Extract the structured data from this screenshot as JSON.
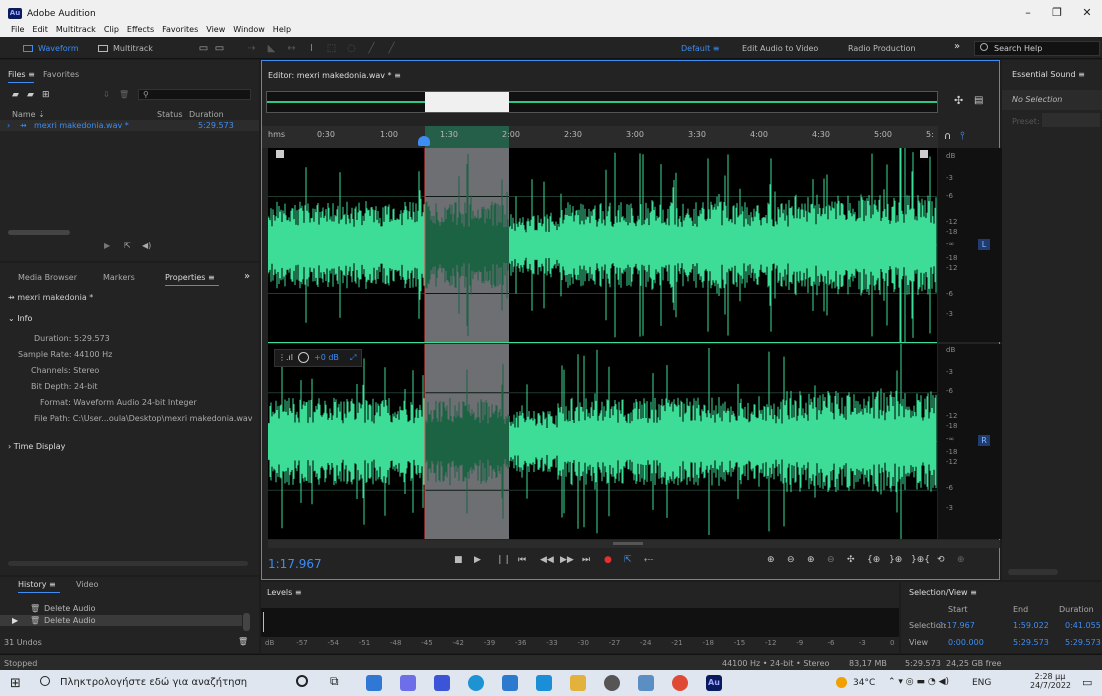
{
  "window": {
    "title": "Adobe Audition",
    "app_badge": "Au"
  },
  "menu": [
    "File",
    "Edit",
    "Multitrack",
    "Clip",
    "Effects",
    "Favorites",
    "View",
    "Window",
    "Help"
  ],
  "toolbar": {
    "waveform_label": "Waveform",
    "multitrack_label": "Multitrack",
    "workspaces": [
      "Default",
      "Edit Audio to Video",
      "Radio Production"
    ],
    "more_glyph": "»",
    "search_placeholder": "Search Help"
  },
  "files_panel": {
    "tabs": [
      "Files",
      "Favorites"
    ],
    "col_name": "Name",
    "col_status": "Status",
    "col_duration": "Duration",
    "file_name": "mexri makedonia.wav *",
    "file_duration": "5:29.573"
  },
  "properties_panel": {
    "tabs": [
      "Media Browser",
      "Markers",
      "Properties"
    ],
    "more_glyph": "»",
    "item_title": "mexri makedonia *",
    "info_header": "Info",
    "info_rows": [
      "Duration: 5:29.573",
      "Sample Rate: 44100 Hz",
      "Channels: Stereo",
      "Bit Depth: 24-bit",
      "Format: Waveform Audio 24-bit Integer",
      "File Path: C:\\User...oula\\Desktop\\mexri makedonia.wav"
    ],
    "time_display_header": "Time Display"
  },
  "history_panel": {
    "tabs": [
      "History",
      "Video"
    ],
    "items": [
      "Delete Audio",
      "Delete Audio"
    ],
    "undos": "31 Undos"
  },
  "editor": {
    "title": "Editor: mexri makedonia.wav *",
    "ruler_unit": "hms",
    "ruler_ticks": [
      "0:30",
      "1:00",
      "1:30",
      "2:00",
      "2:30",
      "3:00",
      "3:30",
      "4:00",
      "4:30",
      "5:00",
      "5:"
    ],
    "db_scale_top": [
      "dB",
      "-3",
      "-6",
      "-12",
      "-18",
      "-∞",
      "-18",
      "-12",
      "-6",
      "-3"
    ],
    "db_scale_bottom": [
      "dB",
      "-3",
      "-6",
      "-12",
      "-18",
      "-∞",
      "-18",
      "-12",
      "-6",
      "-3"
    ],
    "channel_left": "L",
    "channel_right": "R",
    "gain_label": "+0 dB",
    "current_time": "1:17.967",
    "wave_color": "#3ddc97",
    "selection_color": "#f2f6ff",
    "accent_color": "#3d8df4"
  },
  "essential_sound": {
    "title": "Essential Sound",
    "no_selection": "No Selection",
    "preset_label": "Preset:"
  },
  "levels": {
    "title": "Levels",
    "scale": [
      "dB",
      "-57",
      "-54",
      "-51",
      "-48",
      "-45",
      "-42",
      "-39",
      "-36",
      "-33",
      "-30",
      "-27",
      "-24",
      "-21",
      "-18",
      "-15",
      "-12",
      "-9",
      "-6",
      "-3",
      "0"
    ]
  },
  "selection_view": {
    "title": "Selection/View",
    "col_start": "Start",
    "col_end": "End",
    "col_duration": "Duration",
    "row_selection": "Selection",
    "row_view": "View",
    "sel_start": "1:17.967",
    "sel_end": "1:59.022",
    "sel_duration": "0:41.055",
    "view_start": "0:00.000",
    "view_end": "5:29.573",
    "view_duration": "5:29.573"
  },
  "status": {
    "state": "Stopped",
    "format": "44100 Hz • 24-bit • Stereo",
    "size": "83,17 MB",
    "duration": "5:29.573",
    "free": "24,25 GB free"
  },
  "taskbar": {
    "search_placeholder": "Πληκτρολογήστε εδώ για αναζήτηση",
    "weather": "34°C",
    "lang": "ENG",
    "time": "2:28 μμ",
    "date": "24/7/2022"
  }
}
